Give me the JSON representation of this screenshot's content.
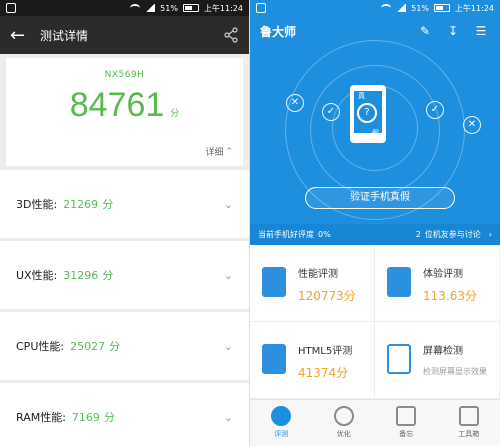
{
  "status": {
    "battery": "51%",
    "time": "上午11:24"
  },
  "left": {
    "title": "测试详情",
    "device": "NX569H",
    "score": "84761",
    "score_unit": "分",
    "detail": "详细",
    "rows": [
      {
        "label": "3D性能:",
        "value": "21269",
        "unit": "分"
      },
      {
        "label": "UX性能:",
        "value": "31296",
        "unit": "分"
      },
      {
        "label": "CPU性能:",
        "value": "25027",
        "unit": "分"
      },
      {
        "label": "RAM性能:",
        "value": "7169",
        "unit": "分"
      }
    ]
  },
  "right": {
    "title": "鲁大师",
    "phone_label_top": "真",
    "phone_label_bottom": "假",
    "verify_button": "验证手机真假",
    "info_left": "当前手机好评度",
    "info_ratio": "0%",
    "info_count": "2",
    "info_right": "位机友参与讨论",
    "cells": [
      {
        "name": "性能评测",
        "score": "120773分"
      },
      {
        "name": "体验评测",
        "score": "113.63分"
      },
      {
        "name": "HTML5评测",
        "score": "41374分"
      },
      {
        "name": "屏幕检测",
        "sub": "检测屏幕显示效果"
      }
    ],
    "tabs": [
      "评测",
      "优化",
      "备忘",
      "工具箱"
    ]
  },
  "colors": {
    "green": "#59b84e",
    "blue": "#1e8fdf",
    "orange": "#f4a126"
  }
}
